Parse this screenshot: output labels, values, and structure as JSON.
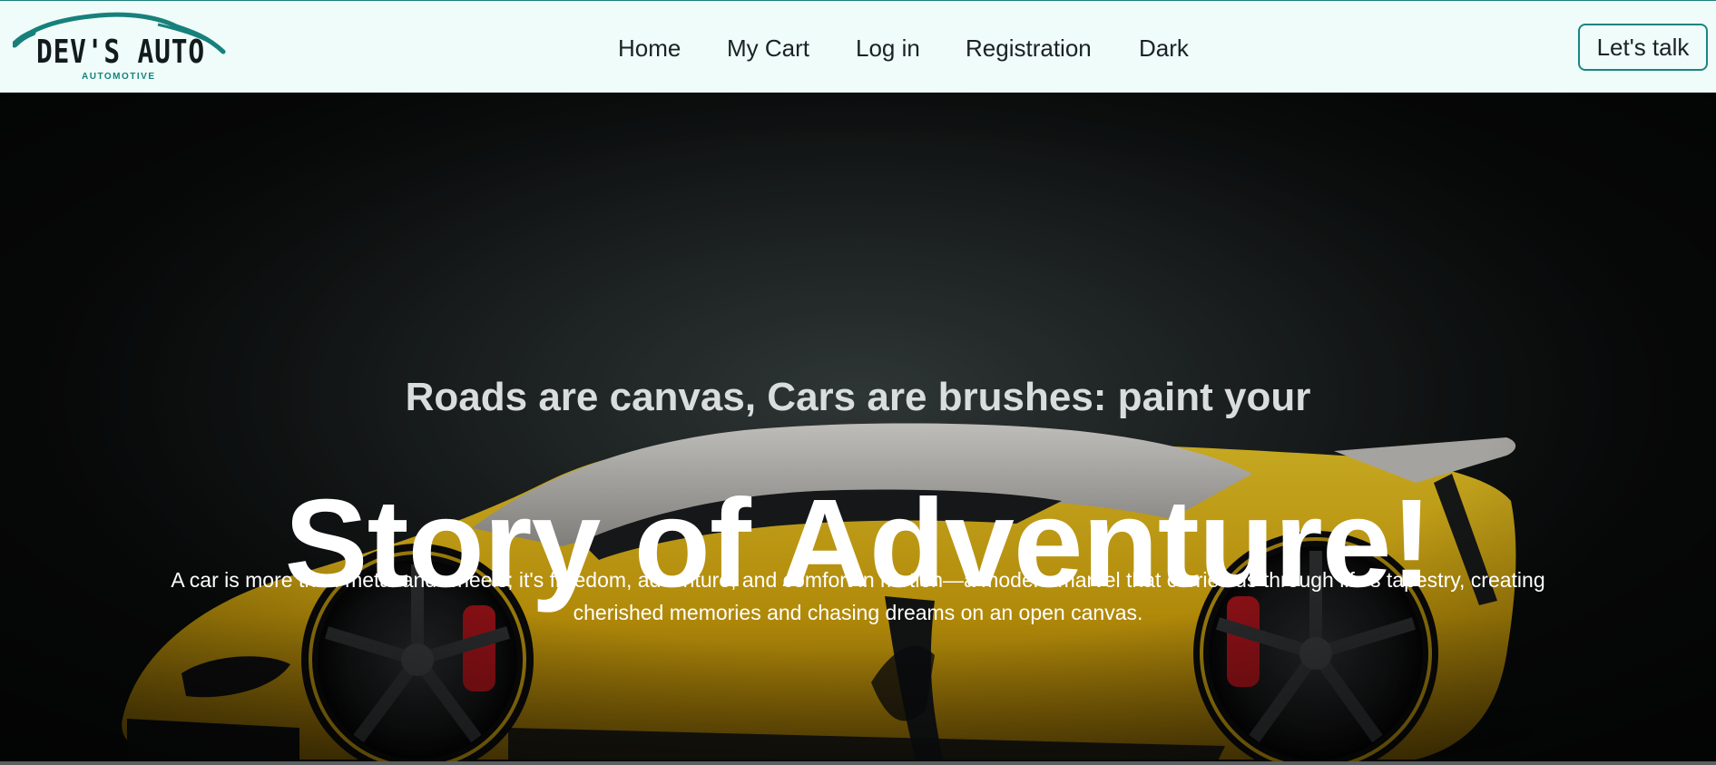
{
  "brand": {
    "name": "DEV'S AUTO",
    "subtitle": "AUTOMOTIVE",
    "accent_color": "#1b8580"
  },
  "nav": {
    "links": [
      {
        "label": "Home"
      },
      {
        "label": "My Cart"
      },
      {
        "label": "Log in"
      },
      {
        "label": "Registration"
      },
      {
        "label": "Dark"
      }
    ],
    "cta_label": "Let's talk"
  },
  "hero": {
    "tagline": "Roads are canvas, Cars are brushes: paint your",
    "headline": "Story of Adventure!",
    "description": "A car is more than metal and wheels; it's freedom, adventure, and comfort in motion—a modern marvel that carries us through life's tapestry, creating cherished memories and chasing dreams on an open canvas.",
    "car_color": "#e0b10e"
  }
}
